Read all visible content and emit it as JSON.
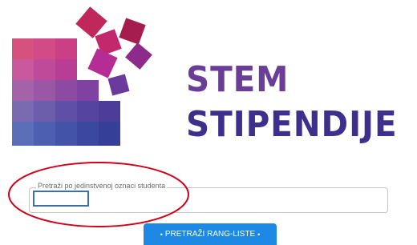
{
  "logo": {
    "line1": "STEM",
    "line2": "STIPENDIJE",
    "colors": {
      "line1": "#6a3d97",
      "line2": "#3f2f8d",
      "mosaic_accent": "#b52158"
    }
  },
  "search": {
    "legend": "Pretraži po jedinstvenoj oznaci studenta",
    "value": ""
  },
  "search_button": {
    "bullet_left": "•",
    "label": "PRETRAŽI RANG-LISTE",
    "bullet_right": "•",
    "color": "#1e88e5"
  },
  "annotation": {
    "color": "#d0021b"
  }
}
